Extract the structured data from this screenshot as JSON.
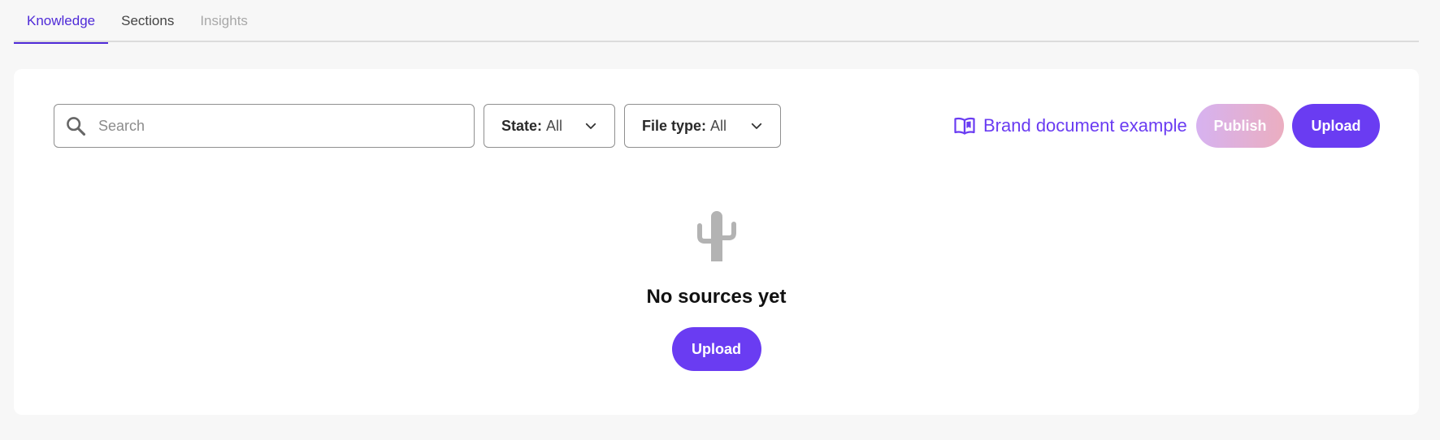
{
  "tabs": [
    {
      "label": "Knowledge",
      "state": "active"
    },
    {
      "label": "Sections",
      "state": "default"
    },
    {
      "label": "Insights",
      "state": "disabled"
    }
  ],
  "colors": {
    "accent": "#6a3cf2",
    "tab_active": "#4f2bd8",
    "publish_gradient_start": "#d5aef0",
    "publish_gradient_end": "#eaaabd",
    "empty_icon": "#b3b3b3"
  },
  "toolbar": {
    "search": {
      "placeholder": "Search",
      "value": "",
      "icon": "search-icon"
    },
    "filters": [
      {
        "label": "State:",
        "value": "All",
        "icon": "chevron-down-icon"
      },
      {
        "label": "File type:",
        "value": "All",
        "icon": "chevron-down-icon"
      }
    ],
    "brand_link": {
      "label": "Brand document example",
      "icon": "open-book-icon"
    },
    "publish_label": "Publish",
    "upload_label": "Upload"
  },
  "empty_state": {
    "icon": "cactus-icon",
    "title": "No sources yet",
    "upload_label": "Upload"
  }
}
